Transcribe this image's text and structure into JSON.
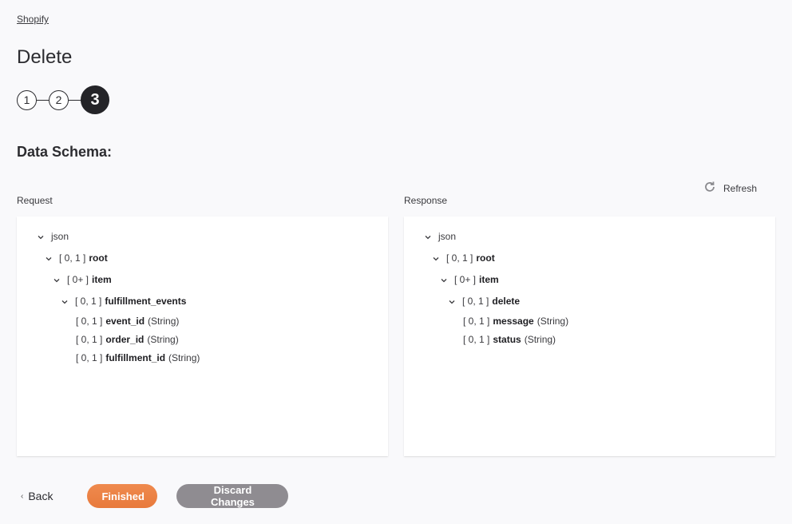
{
  "breadcrumb": "Shopify",
  "page_title": "Delete",
  "stepper": {
    "steps": [
      "1",
      "2",
      "3"
    ],
    "active_step": 3
  },
  "section_title": "Data Schema:",
  "refresh_label": "Refresh",
  "request": {
    "label": "Request",
    "tree": [
      {
        "level": 0,
        "expandable": true,
        "card": "",
        "name": "json",
        "type": "",
        "bold": false
      },
      {
        "level": 1,
        "expandable": true,
        "card": "[ 0, 1 ]",
        "name": "root",
        "type": "",
        "bold": true
      },
      {
        "level": 2,
        "expandable": true,
        "card": "[ 0+ ]",
        "name": "item",
        "type": "",
        "bold": true
      },
      {
        "level": 3,
        "expandable": true,
        "card": "[ 0, 1 ]",
        "name": "fulfillment_events",
        "type": "",
        "bold": true
      },
      {
        "level": 4,
        "expandable": false,
        "card": "[ 0, 1 ]",
        "name": "event_id",
        "type": "(String)",
        "bold": true
      },
      {
        "level": 4,
        "expandable": false,
        "card": "[ 0, 1 ]",
        "name": "order_id",
        "type": "(String)",
        "bold": true
      },
      {
        "level": 4,
        "expandable": false,
        "card": "[ 0, 1 ]",
        "name": "fulfillment_id",
        "type": "(String)",
        "bold": true
      }
    ]
  },
  "response": {
    "label": "Response",
    "tree": [
      {
        "level": 0,
        "expandable": true,
        "card": "",
        "name": "json",
        "type": "",
        "bold": false
      },
      {
        "level": 1,
        "expandable": true,
        "card": "[ 0, 1 ]",
        "name": "root",
        "type": "",
        "bold": true
      },
      {
        "level": 2,
        "expandable": true,
        "card": "[ 0+ ]",
        "name": "item",
        "type": "",
        "bold": true
      },
      {
        "level": 3,
        "expandable": true,
        "card": "[ 0, 1 ]",
        "name": "delete",
        "type": "",
        "bold": true
      },
      {
        "level": 4,
        "expandable": false,
        "card": "[ 0, 1 ]",
        "name": "message",
        "type": "(String)",
        "bold": true
      },
      {
        "level": 4,
        "expandable": false,
        "card": "[ 0, 1 ]",
        "name": "status",
        "type": "(String)",
        "bold": true
      }
    ]
  },
  "footer": {
    "back_label": "Back",
    "finished_label": "Finished",
    "discard_label": "Discard Changes"
  },
  "colors": {
    "primary": "#e87a3c",
    "secondary": "#8f8c91",
    "active_step": "#242428"
  }
}
